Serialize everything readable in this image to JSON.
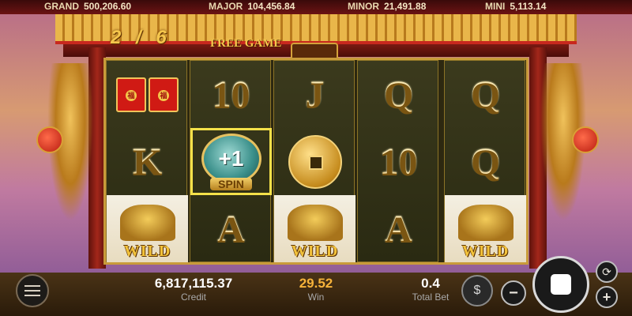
{
  "jackpots": [
    {
      "label": "GRAND",
      "value": "500,206.60"
    },
    {
      "label": "MAJOR",
      "value": "104,456.84"
    },
    {
      "label": "MINOR",
      "value": "21,491.88"
    },
    {
      "label": "MINI",
      "value": "5,113.14"
    }
  ],
  "free_game": {
    "current": "2",
    "separator": "/",
    "total": "6",
    "label": "FREE GAME"
  },
  "reels": [
    [
      "red-envelopes",
      "K",
      "WILD"
    ],
    [
      "10",
      "+1 SPIN",
      "A"
    ],
    [
      "J",
      "coin",
      "WILD"
    ],
    [
      "Q",
      "10",
      "A"
    ],
    [
      "Q",
      "Q",
      "WILD"
    ]
  ],
  "symbols": {
    "wild_text": "WILD",
    "spin_bonus_value": "+1",
    "spin_bonus_label": "SPIN"
  },
  "stats": {
    "credit_value": "6,817,115.37",
    "credit_label": "Credit",
    "win_value": "29.52",
    "win_label": "Win",
    "bet_value": "0.4",
    "bet_label": "Total Bet"
  },
  "controls": {
    "minus": "−",
    "plus": "+",
    "menu_icon": "hamburger-icon",
    "stop_icon": "stop-icon",
    "autoplay_icon": "refresh-icon",
    "coins_icon": "coin-stack-icon"
  },
  "colors": {
    "gold": "#f5c64c",
    "win": "#f6b33a",
    "highlight": "#f4e14a"
  }
}
